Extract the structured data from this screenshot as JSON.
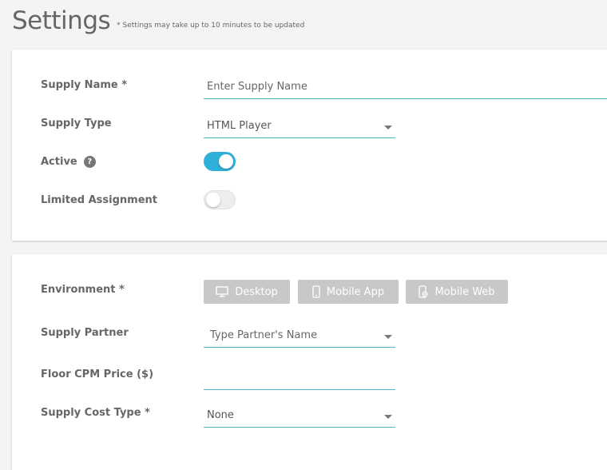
{
  "header": {
    "title": "Settings",
    "note": "* Settings may take up to 10 minutes to be updated"
  },
  "general": {
    "supply_name_label": "Supply Name *",
    "supply_name_placeholder": "Enter Supply Name",
    "supply_type_label": "Supply Type",
    "supply_type_value": "HTML Player",
    "active_label": "Active",
    "active_help": "?",
    "active_on": true,
    "limited_label": "Limited Assignment",
    "limited_on": false
  },
  "details": {
    "environment_label": "Environment *",
    "environment_options": [
      {
        "label": "Desktop",
        "icon": "desktop-icon"
      },
      {
        "label": "Mobile App",
        "icon": "mobile-icon"
      },
      {
        "label": "Mobile Web",
        "icon": "mobile-web-icon"
      }
    ],
    "partner_label": "Supply Partner",
    "partner_placeholder": "Type Partner's Name",
    "floor_label": "Floor CPM Price ($)",
    "floor_value": "",
    "cost_type_label": "Supply Cost Type *",
    "cost_type_value": "None"
  },
  "colors": {
    "accent": "#2fb0d9",
    "underline": "#56b3c4",
    "env_button_bg": "#c8c8c8"
  }
}
